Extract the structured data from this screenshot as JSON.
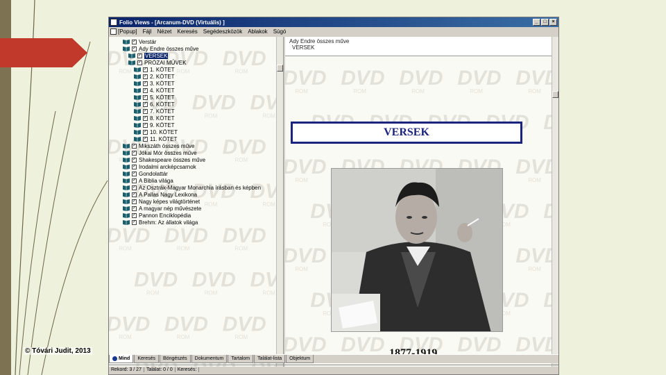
{
  "slide": {
    "copyright": "© Tóvári Judit, 2013"
  },
  "window": {
    "title": "Folio Views - [Arcanum-DVD (Virtuális) ]",
    "controls": [
      "_",
      "□",
      "×"
    ]
  },
  "menu": {
    "items": [
      "[Popup]",
      "Fájl",
      "Nézet",
      "Keresés",
      "Segédeszközök",
      "Ablakok",
      "Súgó"
    ]
  },
  "tree": {
    "items": [
      {
        "label": "Verstár",
        "level": 0
      },
      {
        "label": "Ady Endre összes műve",
        "level": 0
      },
      {
        "label": "VERSEK",
        "level": 1,
        "selected": true
      },
      {
        "label": "PRÓZAI MŰVEK",
        "level": 1
      },
      {
        "label": "1. KÖTET",
        "level": 2
      },
      {
        "label": "2. KÖTET",
        "level": 2
      },
      {
        "label": "3. KÖTET",
        "level": 2
      },
      {
        "label": "4. KÖTET",
        "level": 2
      },
      {
        "label": "5. KÖTET",
        "level": 2
      },
      {
        "label": "6. KÖTET",
        "level": 2
      },
      {
        "label": "7. KÖTET",
        "level": 2
      },
      {
        "label": "8. KÖTET",
        "level": 2
      },
      {
        "label": "9. KÖTET",
        "level": 2
      },
      {
        "label": "10. KÖTET",
        "level": 2
      },
      {
        "label": "11. KÖTET",
        "level": 2
      },
      {
        "label": "Mikszáth összes műve",
        "level": 0
      },
      {
        "label": "Jókai Mór összes műve",
        "level": 0
      },
      {
        "label": "Shakespeare összes műve",
        "level": 0
      },
      {
        "label": "Irodalmi arcképcsarnok",
        "level": 0
      },
      {
        "label": "Gondolattár",
        "level": 0
      },
      {
        "label": "A Biblia világa",
        "level": 0
      },
      {
        "label": "Az Osztrák-Magyar Monarchia írásban és képben",
        "level": 0
      },
      {
        "label": "A Pallas Nagy Lexikona",
        "level": 0
      },
      {
        "label": "Nagy képes világtörténet",
        "level": 0
      },
      {
        "label": "A magyar nép művészete",
        "level": 0
      },
      {
        "label": "Pannon Enciklopédia",
        "level": 0
      },
      {
        "label": "Brehm: Az állatok világa",
        "level": 0
      }
    ]
  },
  "content": {
    "breadcrumb_line1": "Ady Endre összes műve",
    "breadcrumb_line2": "VERSEK",
    "heading": "VERSEK",
    "years": "1877-1919",
    "watermark_text": "DVD",
    "watermark_sub": "ROM"
  },
  "tabs": {
    "items": [
      {
        "label": "Mind",
        "active": true
      },
      {
        "label": "Keresés"
      },
      {
        "label": "Böngészés"
      },
      {
        "label": "Dokumentum"
      },
      {
        "label": "Tartalom"
      },
      {
        "label": "Találat-lista"
      },
      {
        "label": "Objektum"
      }
    ]
  },
  "status": {
    "record": "Rekord: 3 / 27",
    "hits": "Találat: 0 / 0",
    "search": "Keresés:"
  },
  "colors": {
    "heading": "#1a237e",
    "titlebar": "#0a246a",
    "slide_accent": "#c0392b"
  }
}
